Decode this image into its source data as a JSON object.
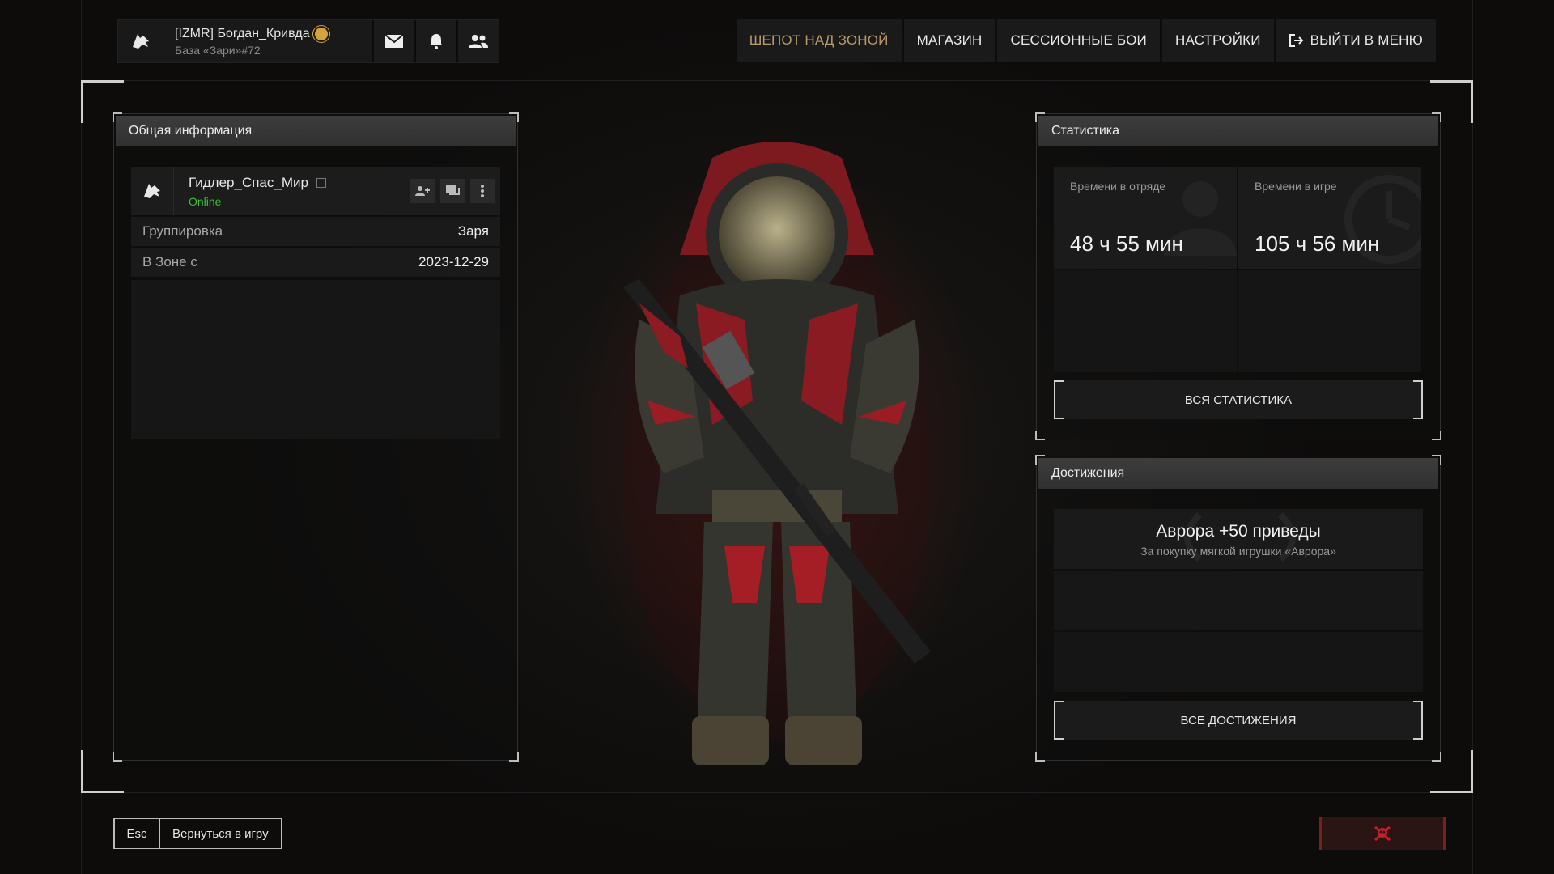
{
  "topbar": {
    "player_name": "[IZMR] Богдан_Кривда",
    "player_base": "База «Зари»#72",
    "icons": [
      "wolf-logo-icon",
      "sun-badge-icon",
      "mail-icon",
      "bell-icon",
      "friends-icon"
    ]
  },
  "nav": {
    "items": [
      "ШЕПОТ НАД ЗОНОЙ",
      "МАГАЗИН",
      "СЕССИОННЫЕ БОИ",
      "НАСТРОЙКИ"
    ],
    "active_index": 0,
    "exit_label": "ВЫЙТИ В МЕНЮ"
  },
  "general": {
    "title": "Общая информация",
    "profile_name": "Гидлер_Спас_Мир",
    "status": "Online",
    "rows": [
      {
        "key": "Группировка",
        "value": "Заря"
      },
      {
        "key": "В Зоне с",
        "value": "2023-12-29"
      }
    ]
  },
  "stats": {
    "title": "Статистика",
    "items": [
      {
        "label": "Времени в отряде",
        "value": "48 ч 55 мин"
      },
      {
        "label": "Времени в игре",
        "value": "105 ч 56 мин"
      }
    ],
    "all_button": "ВСЯ СТАТИСТИКА"
  },
  "achievements": {
    "title": "Достижения",
    "items": [
      {
        "title": "Аврора +50 приведы",
        "desc": "За покупку мягкой игрушки «Аврора»"
      }
    ],
    "all_button": "ВСЕ ДОСТИЖЕНИЯ"
  },
  "footer": {
    "esc_key": "Esc",
    "back_label": "Вернуться в игру"
  },
  "colors": {
    "accent_nav": "#b99b6a",
    "online": "#35c22c",
    "danger": "#b0202a"
  }
}
